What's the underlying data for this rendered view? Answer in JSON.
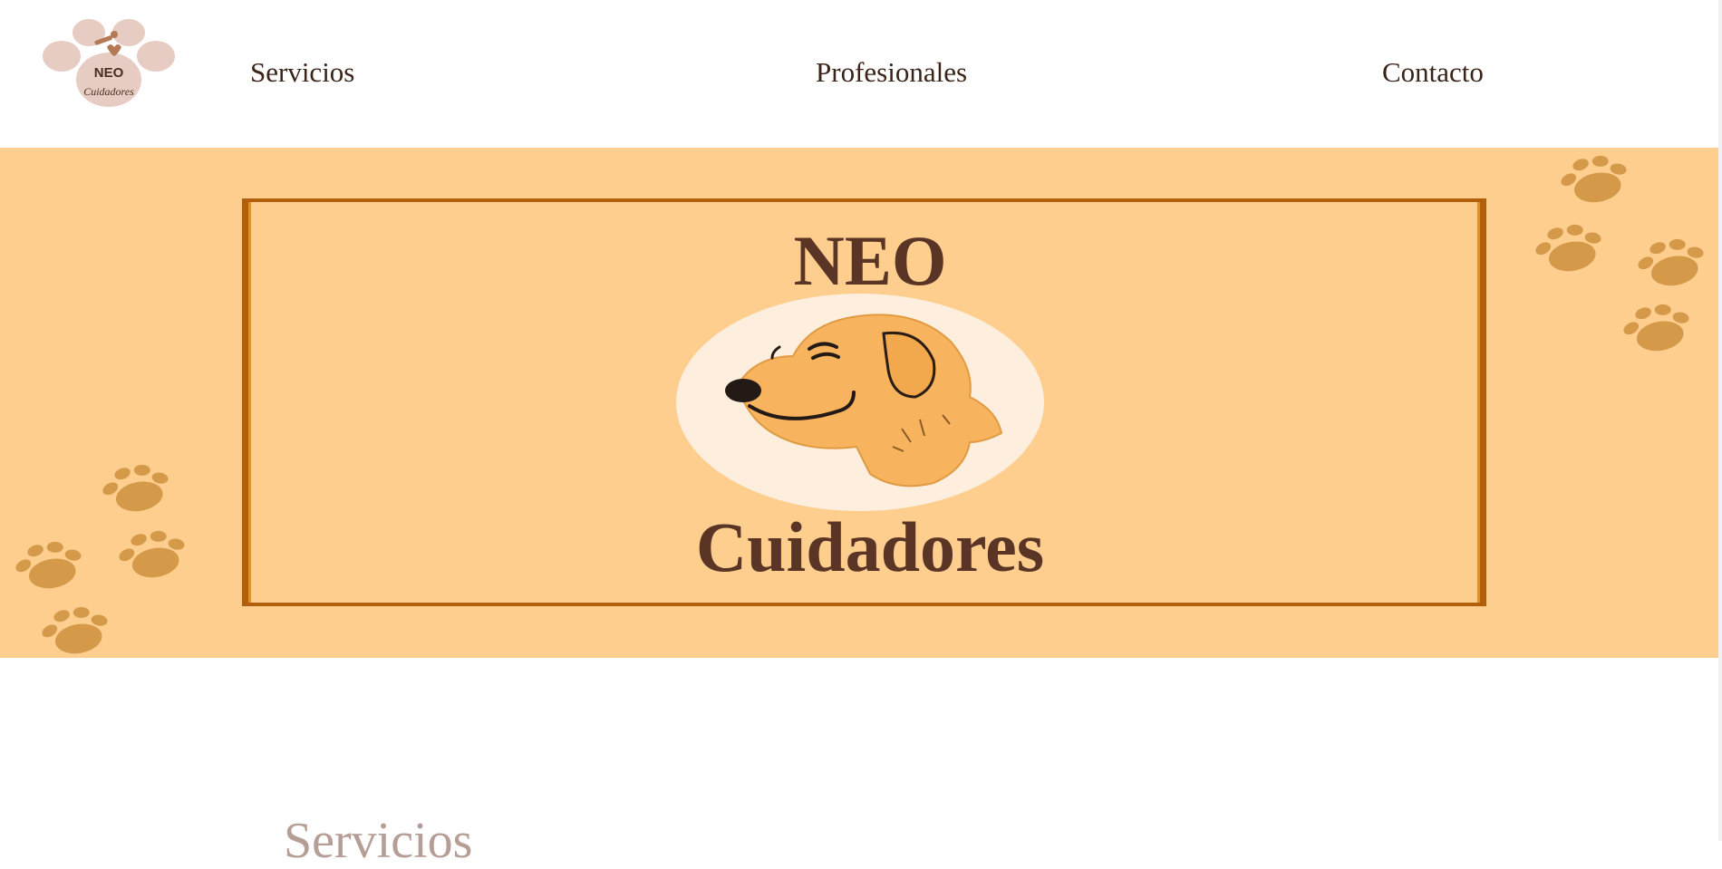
{
  "header": {
    "logo": {
      "line1": "NEO",
      "line2": "Cuidadores"
    },
    "nav": [
      {
        "label": "Servicios"
      },
      {
        "label": "Profesionales"
      },
      {
        "label": "Contacto"
      }
    ]
  },
  "hero": {
    "title_top": "NEO",
    "title_bottom": "Cuidadores",
    "image": "smiling-dog-head-illustration"
  },
  "section": {
    "heading": "Servicios"
  },
  "colors": {
    "hero_bg": "#fdce8e",
    "frame": "#b25f0c",
    "title": "#5a3526",
    "paw": "#d49a4a",
    "badge": "#fdeedd"
  }
}
